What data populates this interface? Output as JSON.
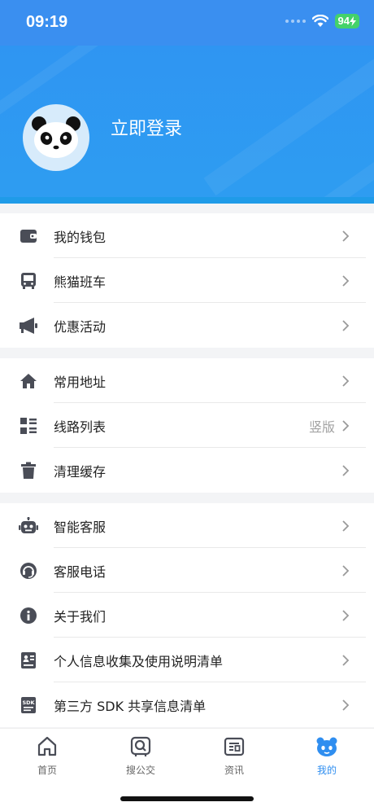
{
  "status_bar": {
    "time": "09:19",
    "battery": "94"
  },
  "profile": {
    "login_label": "立即登录"
  },
  "sections": [
    {
      "items": [
        {
          "label": "我的钱包",
          "icon": "wallet-icon"
        },
        {
          "label": "熊猫班车",
          "icon": "bus-icon"
        },
        {
          "label": "优惠活动",
          "icon": "megaphone-icon"
        }
      ]
    },
    {
      "items": [
        {
          "label": "常用地址",
          "icon": "home-icon"
        },
        {
          "label": "线路列表",
          "icon": "list-icon",
          "extra": "竖版"
        },
        {
          "label": "清理缓存",
          "icon": "trash-icon"
        }
      ]
    },
    {
      "items": [
        {
          "label": "智能客服",
          "icon": "robot-icon"
        },
        {
          "label": "客服电话",
          "icon": "headset-icon"
        },
        {
          "label": "关于我们",
          "icon": "info-icon"
        },
        {
          "label": "个人信息收集及使用说明清单",
          "icon": "id-card-icon"
        },
        {
          "label": "第三方 SDK 共享信息清单",
          "icon": "sdk-icon"
        }
      ]
    }
  ],
  "tabbar": {
    "tabs": [
      {
        "label": "首页",
        "icon": "home-outline-icon"
      },
      {
        "label": "搜公交",
        "icon": "search-bus-icon"
      },
      {
        "label": "资讯",
        "icon": "news-icon"
      },
      {
        "label": "我的",
        "icon": "panda-icon",
        "active": true
      }
    ]
  },
  "colors": {
    "accent": "#2f8ef0",
    "header": "#2f95f2"
  }
}
